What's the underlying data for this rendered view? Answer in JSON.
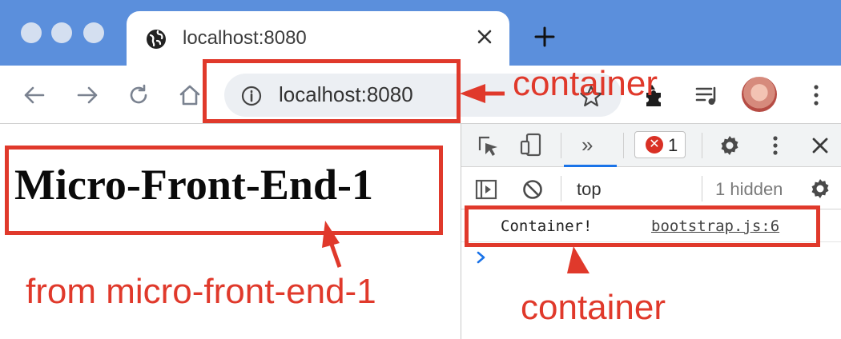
{
  "browser": {
    "tab_title": "localhost:8080",
    "url": "localhost:8080",
    "icons": [
      "globe-icon",
      "close-icon",
      "plus-icon",
      "back-icon",
      "forward-icon",
      "reload-icon",
      "home-icon",
      "info-icon",
      "star-icon",
      "puzzle-icon",
      "media-icon",
      "menu-icon"
    ]
  },
  "page": {
    "heading": "Micro-Front-End-1"
  },
  "devtools": {
    "more_tabs": "»",
    "error_count": "1",
    "context": "top",
    "hidden": "1 hidden",
    "console": [
      {
        "message": "Container!",
        "source": "bootstrap.js:6"
      }
    ]
  },
  "annotations": {
    "url_label": "container",
    "heading_label": "from micro-front-end-1",
    "console_label": "container",
    "color": "#e0392b"
  }
}
